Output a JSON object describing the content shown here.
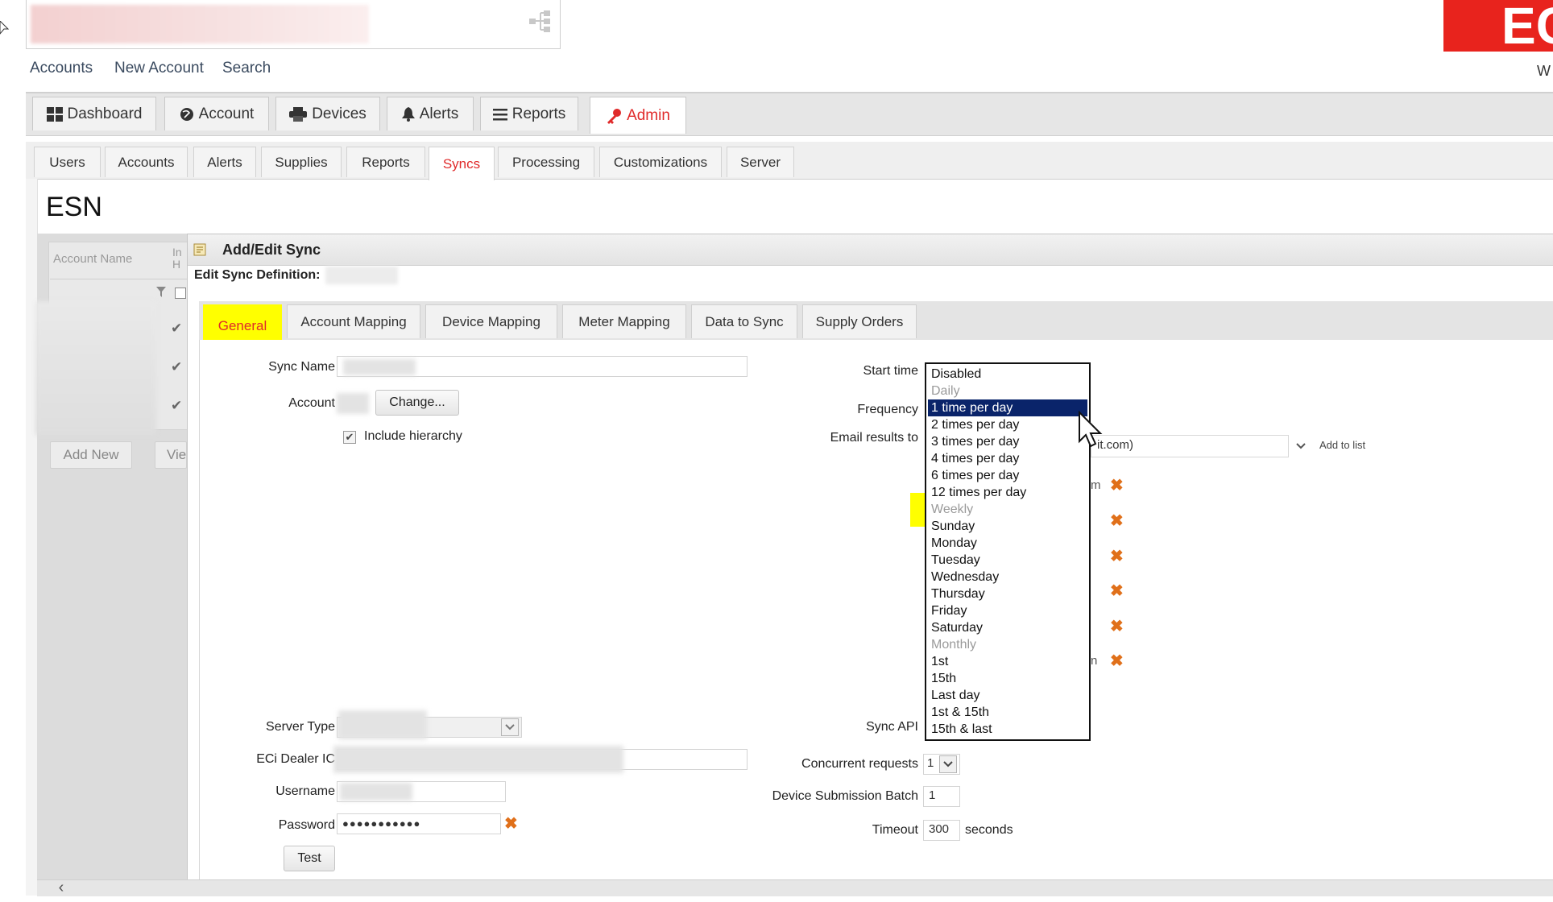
{
  "top_links": [
    "Accounts",
    "New Account",
    "Search"
  ],
  "brand": {
    "logo_text": "EC",
    "sub_text": "W",
    "color": "#e8231d"
  },
  "main_tabs": [
    {
      "label": "Dashboard",
      "icon": "dashboard-icon"
    },
    {
      "label": "Account",
      "icon": "globe-icon"
    },
    {
      "label": "Devices",
      "icon": "printer-icon"
    },
    {
      "label": "Alerts",
      "icon": "bell-icon"
    },
    {
      "label": "Reports",
      "icon": "list-icon"
    },
    {
      "label": "Admin",
      "icon": "key-icon",
      "active": true
    }
  ],
  "sub_tabs": [
    "Users",
    "Accounts",
    "Alerts",
    "Supplies",
    "Reports",
    "Syncs",
    "Processing",
    "Customizations",
    "Server"
  ],
  "active_sub_tab": "Syncs",
  "page_title": "ESN",
  "left_panel": {
    "column_header": "Account Name",
    "column_header_2": "In H",
    "add_button": "Add New",
    "view_button": "Vie"
  },
  "dialog": {
    "title": "Add/Edit Sync",
    "edit_label": "Edit Sync Definition:",
    "tabs": [
      "General",
      "Account Mapping",
      "Device Mapping",
      "Meter Mapping",
      "Data to Sync",
      "Supply Orders"
    ],
    "active_tab": "General",
    "left_form": {
      "sync_name_label": "Sync Name",
      "account_label": "Account",
      "change_button": "Change...",
      "include_hierarchy_label": "Include hierarchy",
      "include_hierarchy_checked": true,
      "server_type_label": "Server Type",
      "dealer_id_label": "ECi Dealer IC",
      "username_label": "Username",
      "password_label": "Password",
      "password_value": "●●●●●●●●●●●",
      "test_button": "Test"
    },
    "right_form": {
      "start_time_label": "Start time",
      "frequency_label": "Frequency",
      "email_results_label": "Email results to",
      "email_value": "it.com)",
      "add_to_list": "Add to list",
      "email_row_suffixes": [
        "m",
        "",
        "",
        "",
        "",
        "n"
      ],
      "sync_api_label": "Sync API",
      "concurrent_label": "Concurrent requests",
      "concurrent_value": "1",
      "batch_label": "Device Submission Batch",
      "batch_value": "1",
      "timeout_label": "Timeout",
      "timeout_value": "300",
      "timeout_unit": "seconds"
    },
    "frequency_options": [
      {
        "label": "Disabled"
      },
      {
        "label": "Daily",
        "group": true
      },
      {
        "label": "1 time per day",
        "selected": true
      },
      {
        "label": "2 times per day"
      },
      {
        "label": "3 times per day"
      },
      {
        "label": "4 times per day"
      },
      {
        "label": "6 times per day"
      },
      {
        "label": "12 times per day"
      },
      {
        "label": "Weekly",
        "group": true,
        "highlighted": true
      },
      {
        "label": "Sunday"
      },
      {
        "label": "Monday"
      },
      {
        "label": "Tuesday"
      },
      {
        "label": "Wednesday"
      },
      {
        "label": "Thursday"
      },
      {
        "label": "Friday"
      },
      {
        "label": "Saturday"
      },
      {
        "label": "Monthly",
        "group": true
      },
      {
        "label": "1st"
      },
      {
        "label": "15th"
      },
      {
        "label": "Last day"
      },
      {
        "label": "1st & 15th"
      },
      {
        "label": "15th & last"
      }
    ]
  }
}
